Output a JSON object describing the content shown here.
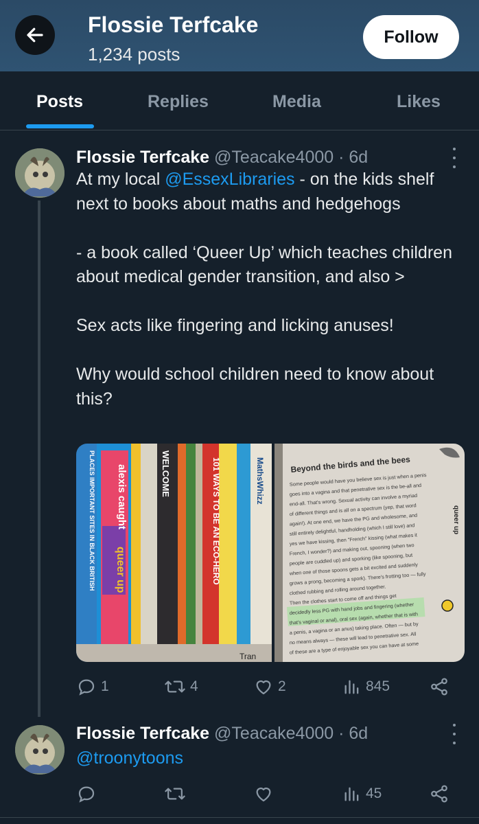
{
  "header": {
    "title": "Flossie Terfcake",
    "subtitle": "1,234 posts",
    "follow_label": "Follow"
  },
  "tabs": [
    "Posts",
    "Replies",
    "Media",
    "Likes"
  ],
  "tweet1": {
    "name": "Flossie Terfcake",
    "handle": "@Teacake4000",
    "time": "· 6d",
    "text": {
      "p1_before": "At my local ",
      "p1_mention": "@EssexLibraries",
      "p1_after": " - on the kids shelf next to books about maths and hedgehogs",
      "p2": "- a book called ‘Queer Up’ which teaches children about medical gender transition, and also >",
      "p3": "Sex acts like fingering and licking anuses!",
      "p4": "Why would school children need to know about this?"
    },
    "media": {
      "left_spines": [
        "alexis caught",
        "queer up",
        "PLACES IMPORTANT SITES IN BLACK BRITISH",
        "WELCOME",
        "101 WAYS TO BE AN ECO-HERO",
        "MathsWhizz",
        "Tran"
      ],
      "right_page": {
        "heading": "Beyond the birds and the bees",
        "side": "queer up",
        "lines": [
          "Some people would have you believe sex is just when a penis",
          "goes into a vagina and that penetrative sex is the be-all and",
          "end-all. That's wrong. Sexual activity can involve a myriad",
          "of different things and is all on a spectrum (yep, that word",
          "again!). At one end, we have the PG and wholesome, and",
          "still entirely delightful, handholding (which I still love) and",
          "yes we have kissing, then \"French\" kissing (what makes it",
          "French, I wonder?) and making out, spooning (when two",
          "people are cuddled up) and sporking (like spooning, but",
          "when one of those spoons gets a bit excited and suddenly",
          "grows a prong, becoming a spork). There's frotting too — fully",
          "clothed rubbing and rolling around together.",
          "Then the clothes start to come off and things get",
          "decidedly less PG with hand jobs and fingering (whether",
          "that's vaginal or anal), oral sex (again, whether that is with",
          "a penis, a vagina or an anus) taking place. Often — but by",
          "no means always — these will lead to penetrative sex. All",
          "of these are a type of enjoyable sex you can have at some"
        ]
      }
    },
    "stats": {
      "replies": "1",
      "reposts": "4",
      "likes": "2",
      "views": "845"
    }
  },
  "tweet2": {
    "name": "Flossie Terfcake",
    "handle": "@Teacake4000",
    "time": "· 6d",
    "text": "@troonytoons",
    "stats": {
      "views": "45"
    }
  },
  "colors": {
    "background": "#15202b",
    "accent": "#1d9bf0",
    "muted": "#8b98a5"
  },
  "icons": [
    "back-arrow-icon",
    "more-icon",
    "reply-icon",
    "repost-icon",
    "like-icon",
    "views-icon",
    "share-icon"
  ]
}
